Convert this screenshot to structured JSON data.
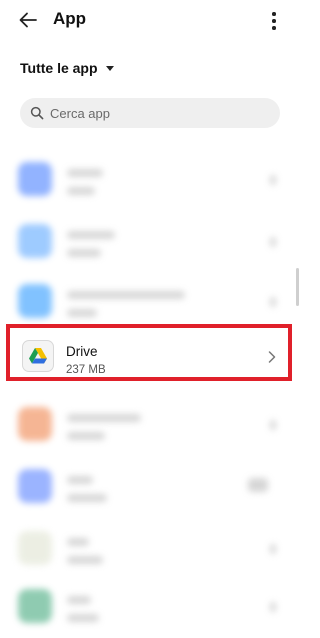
{
  "header": {
    "title": "App",
    "back_icon": "arrow-left-icon",
    "more_icon": "more-vert-icon"
  },
  "filter": {
    "label": "Tutte le app",
    "caret_icon": "caret-down-icon"
  },
  "search": {
    "placeholder": "Cerca app",
    "value": "",
    "icon": "search-icon"
  },
  "apps": [
    {
      "name": "",
      "size": "",
      "color": "#7fa6ff",
      "blurred": true
    },
    {
      "name": "",
      "size": "",
      "color": "#8ec2ff",
      "blurred": true
    },
    {
      "name": "",
      "size": "",
      "color": "#6cb8ff",
      "blurred": true
    },
    {
      "name": "Drive",
      "size": "237 MB",
      "icon": "google-drive-icon",
      "blurred": false,
      "highlighted": true
    },
    {
      "name": "",
      "size": "",
      "color": "#f4a982",
      "blurred": true
    },
    {
      "name": "",
      "size": "",
      "color": "#8aa7ff",
      "blurred": true
    },
    {
      "name": "",
      "size": "",
      "color": "#e9ecdf",
      "blurred": true
    },
    {
      "name": "",
      "size": "",
      "color": "#7cc3a4",
      "blurred": true
    }
  ],
  "colors": {
    "highlight_border": "#e0202a",
    "drive_green": "#1e9e53",
    "drive_yellow": "#f5c000",
    "drive_blue": "#2f6fe0"
  }
}
